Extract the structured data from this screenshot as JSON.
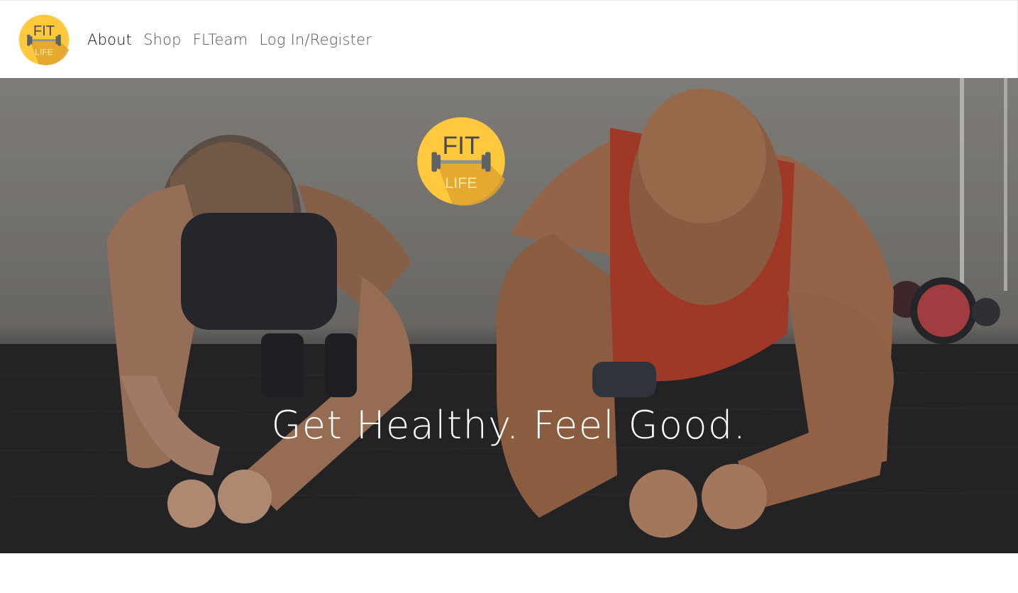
{
  "brand": {
    "logo_top": "FIT",
    "logo_bottom": "LIFE",
    "colors": {
      "logo_circle": "#FFC83D",
      "logo_shadow": "#E0A32E",
      "logo_text": "#4a4a4a",
      "bar": "#6b7075"
    }
  },
  "nav": {
    "items": [
      {
        "label": "About",
        "active": true
      },
      {
        "label": "Shop",
        "active": false
      },
      {
        "label": "FLTeam",
        "active": false
      },
      {
        "label": "Log In/Register",
        "active": false
      }
    ]
  },
  "hero": {
    "tagline": "Get Healthy. Feel Good.",
    "image_description_icon": "people-planking-photo"
  }
}
